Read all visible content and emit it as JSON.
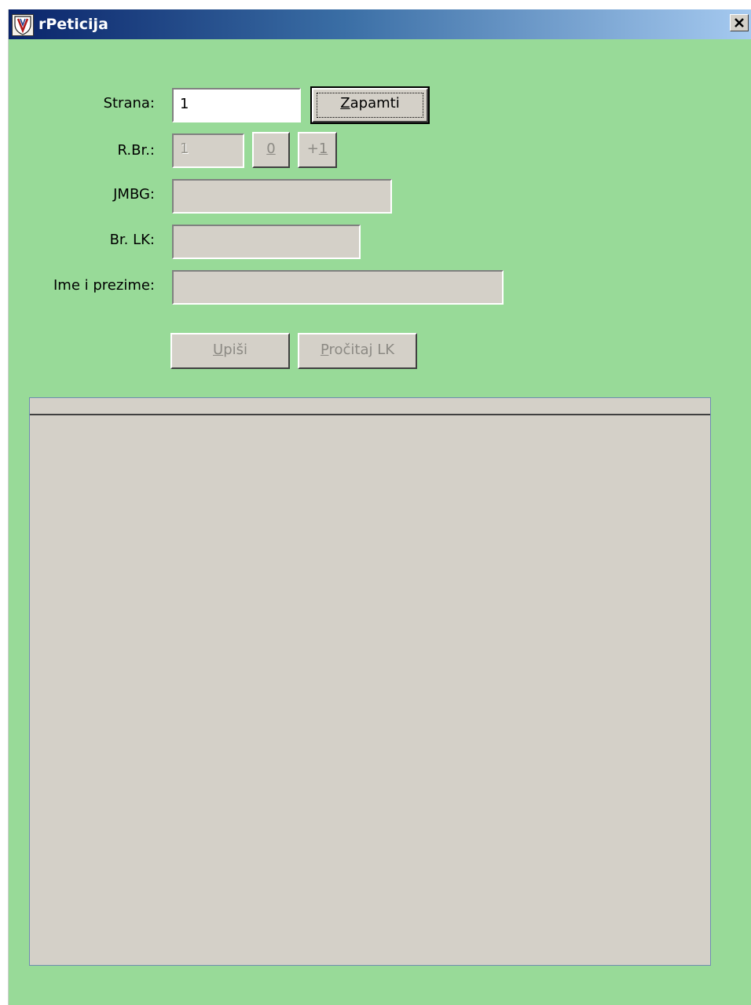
{
  "window": {
    "title": "rPeticija",
    "icon": "shield-emblem-icon",
    "close_icon": "close-x-icon"
  },
  "form": {
    "strana": {
      "label": "Strana:",
      "value": "1"
    },
    "save_button": {
      "label_mnemonic": "Z",
      "label_rest": "apamti"
    },
    "rbr": {
      "label": "R.Br.:",
      "value": "1"
    },
    "zero_button": {
      "label": "0"
    },
    "plus_one_button": {
      "label_prefix": "+",
      "label_mnemonic": "1"
    },
    "jmbg": {
      "label": "JMBG:",
      "value": ""
    },
    "brlk": {
      "label": "Br. LK:",
      "value": ""
    },
    "ime_prezime": {
      "label": "Ime i prezime:",
      "value": ""
    },
    "upisi_button": {
      "label_mnemonic": "U",
      "label_rest": "piši"
    },
    "procitaj_button": {
      "label_mnemonic": "P",
      "label_rest": "ročitaj LK"
    }
  },
  "colors": {
    "background": "#98da98",
    "control_face": "#d4d0c8",
    "title_start": "#0a246a",
    "title_end": "#a6caf0"
  }
}
